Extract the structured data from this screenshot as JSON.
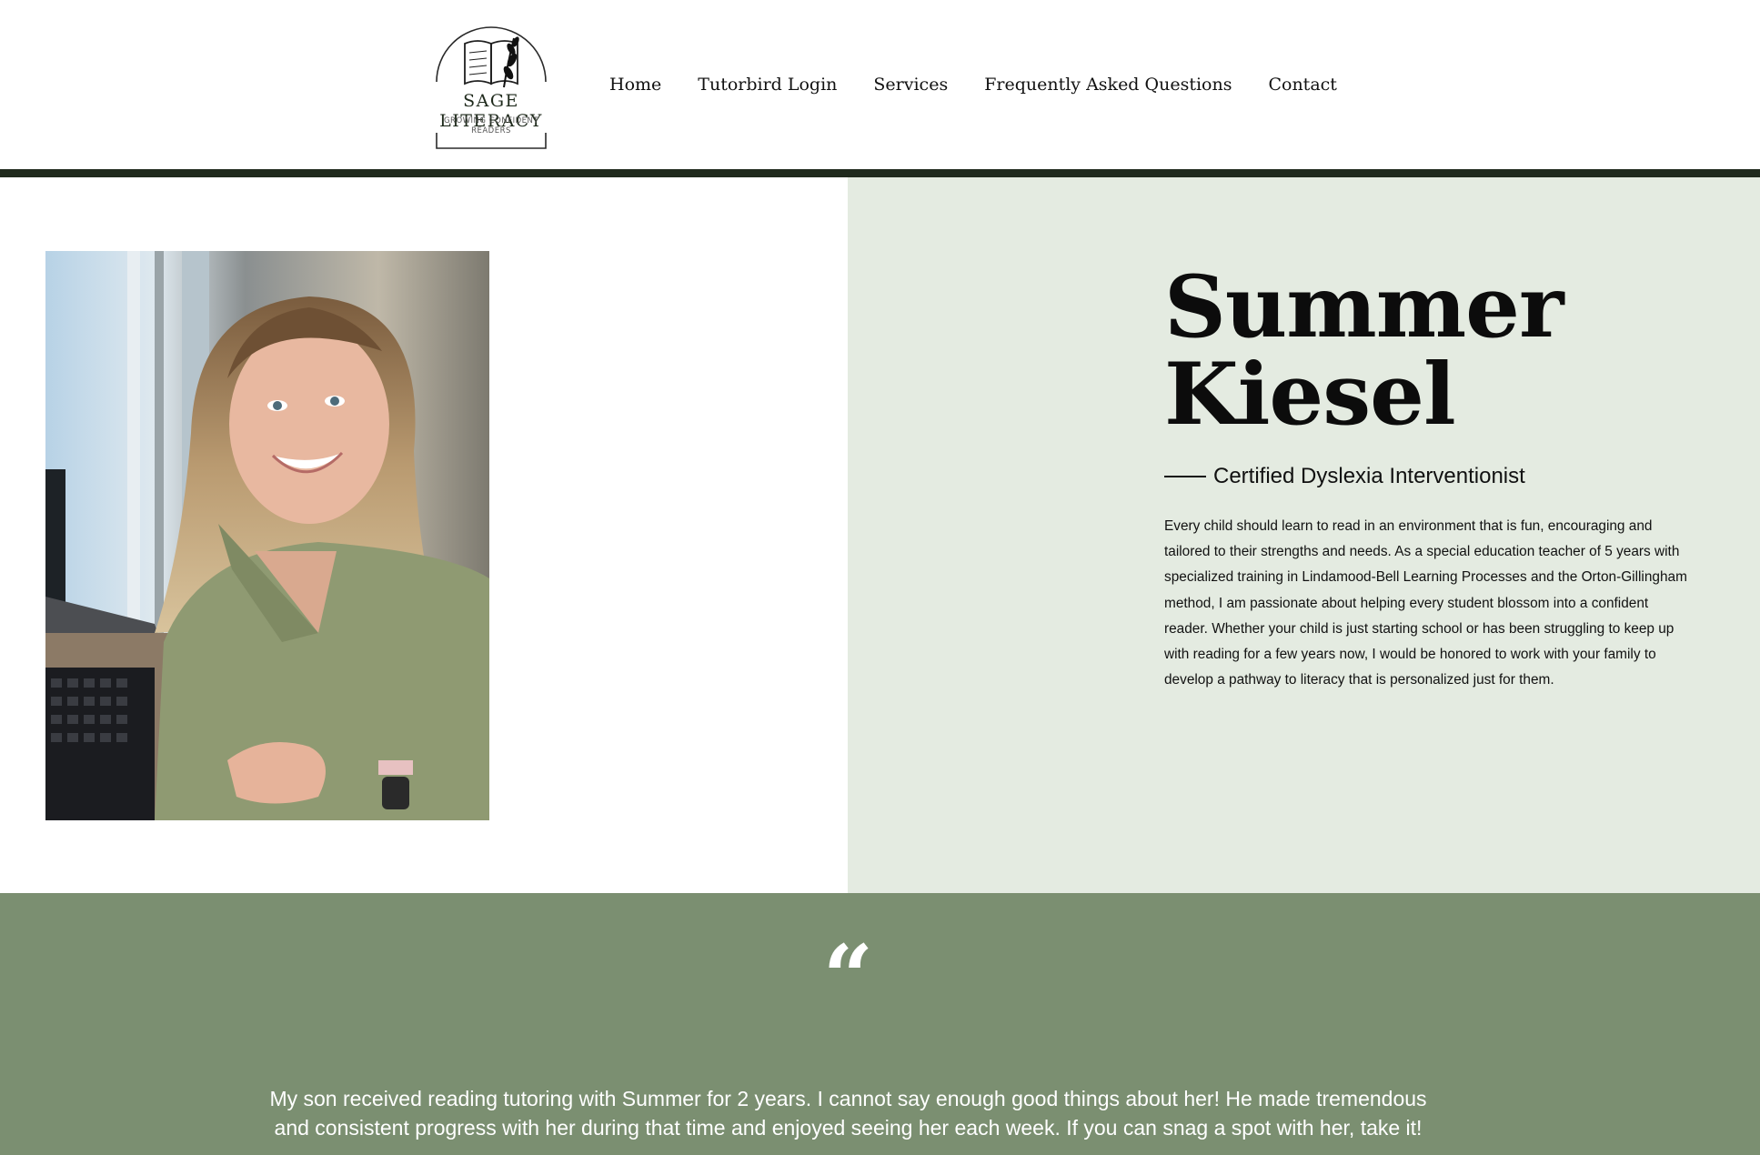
{
  "header": {
    "logo": {
      "title": "SAGE LITERACY",
      "tagline_line1": "GROWING CONFIDENT",
      "tagline_line2": "READERS",
      "icon": "open-book-with-sage-sprig-icon"
    },
    "nav": [
      {
        "label": "Home"
      },
      {
        "label": "Tutorbird Login"
      },
      {
        "label": "Services"
      },
      {
        "label": "Frequently Asked Questions"
      },
      {
        "label": "Contact"
      }
    ]
  },
  "profile": {
    "first_name": "Summer",
    "last_name": "Kiesel",
    "role": "Certified Dyslexia Interventionist",
    "bio": "Every child should learn to read in an environment that is fun, encouraging and tailored to their strengths and needs. As a special education teacher of 5 years with specialized training in Lindamood-Bell Learning Processes and the Orton-Gillingham method, I am passionate about helping every student blossom into a confident reader. Whether your child is just starting school or has been struggling to keep up with reading for a few years now, I would be honored to work with your family to develop a pathway to literacy that is personalized just for them."
  },
  "testimonial": {
    "mark": "“",
    "text": "My son received reading tutoring with Summer for 2 years. I cannot say enough good things about her! He made tremendous and consistent progress with her during that time and enjoyed seeing her each week. If you can snag a spot with her, take it!"
  },
  "colors": {
    "header_divider": "#202a1d",
    "profile_panel": "#e4ebe1",
    "testimonial_bg": "#7b8f71",
    "text": "#111111"
  }
}
